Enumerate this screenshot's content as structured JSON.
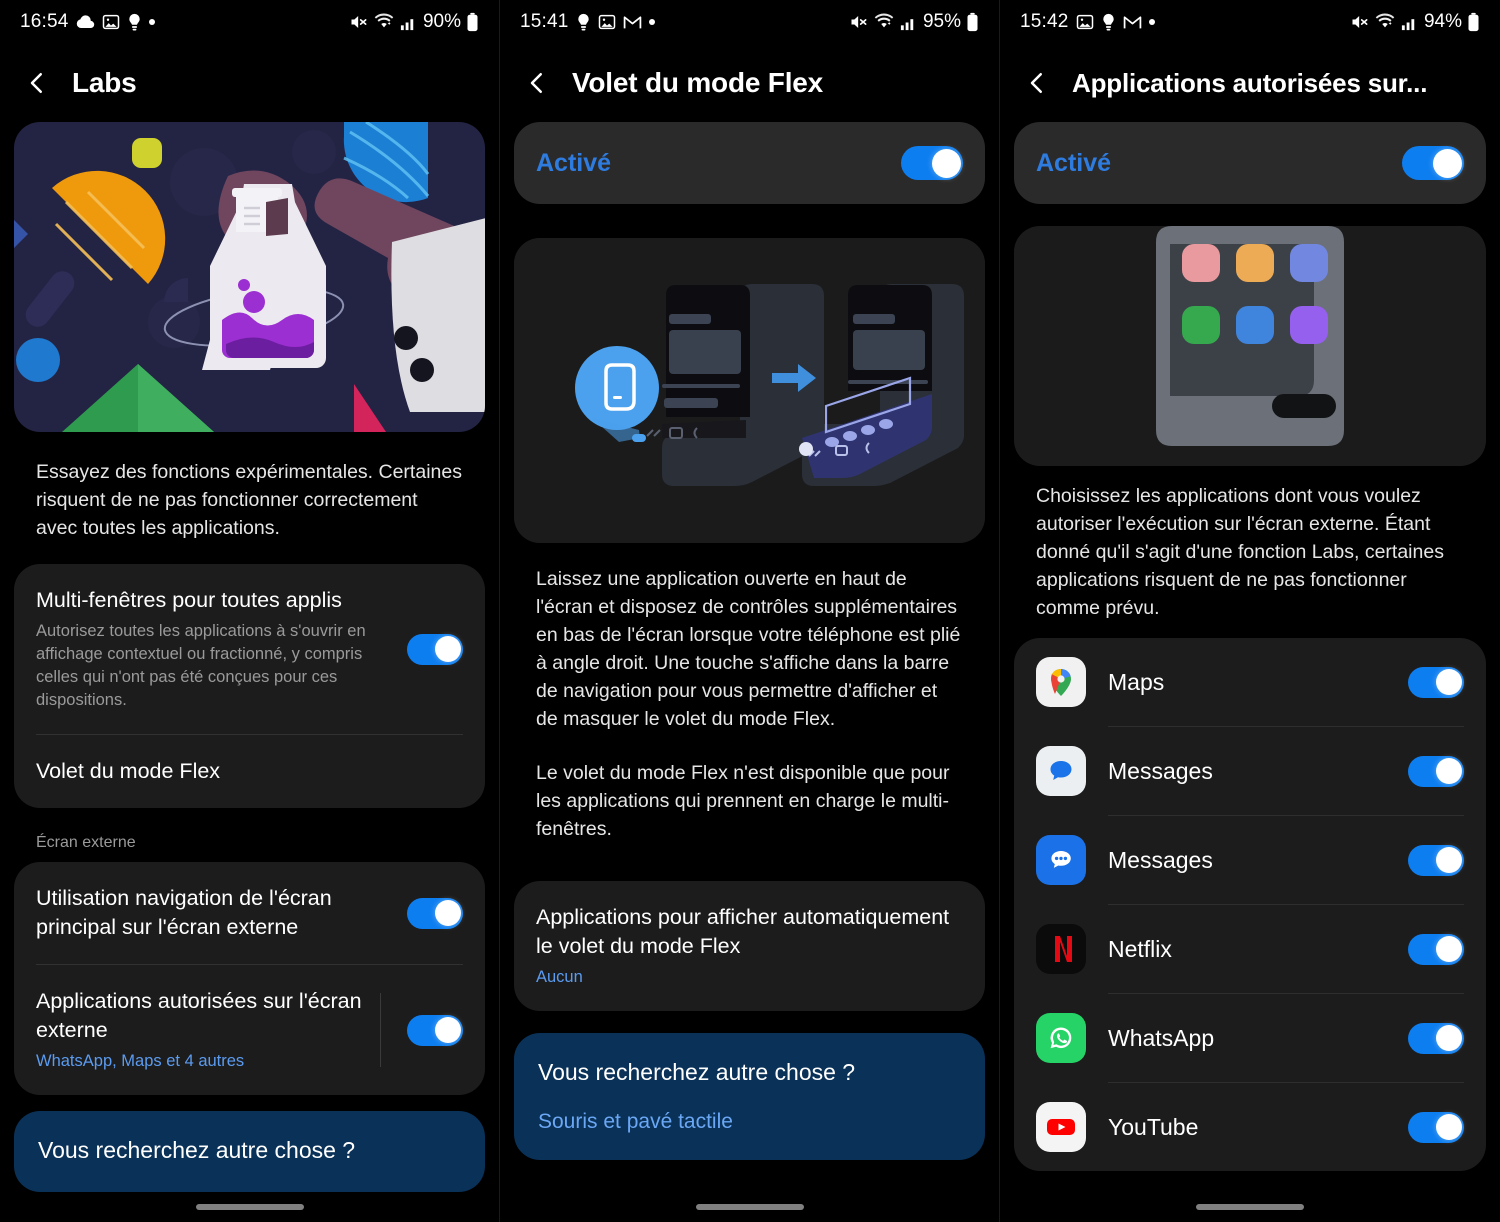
{
  "panels": [
    {
      "status": {
        "time": "16:54",
        "battery": "90%",
        "icons": [
          "cloud-icon",
          "image-icon",
          "bulb-icon",
          "dot-icon"
        ],
        "right_icons": [
          "mute-icon",
          "wifi-icon",
          "signal-icon"
        ]
      },
      "header": {
        "title": "Labs",
        "back": "back-arrow"
      },
      "hero": "labs-illustration",
      "description": "Essayez des fonctions expérimentales. Certaines risquent de ne pas fonctionner correctement avec toutes les applications.",
      "items": [
        {
          "title": "Multi-fenêtres pour toutes applis",
          "sub": "Autorisez toutes les applications à s'ouvrir en affichage contextuel ou fractionné, y compris celles qui n'ont pas été conçues pour ces dispositions.",
          "toggle": true
        },
        {
          "title": "Volet du mode Flex",
          "sub": "",
          "toggle": false
        }
      ],
      "section_label": "Écran externe",
      "external_items": [
        {
          "title": "Utilisation navigation de l'écran principal sur l'écran externe",
          "sub": "",
          "toggle": true,
          "vdiv": false
        },
        {
          "title": "Applications autorisées sur l'écran externe",
          "sub": "WhatsApp, Maps et 4 autres",
          "toggle": true,
          "vdiv": true
        }
      ],
      "promo": {
        "title": "Vous recherchez autre chose ?",
        "link": ""
      }
    },
    {
      "status": {
        "time": "15:41",
        "battery": "95%",
        "icons": [
          "bulb-icon",
          "image-icon",
          "gmail-icon",
          "dot-icon"
        ],
        "right_icons": [
          "mute-icon",
          "wifi-icon",
          "signal-icon"
        ]
      },
      "header": {
        "title": "Volet du mode Flex",
        "back": "back-arrow"
      },
      "activated_label": "Activé",
      "hero": "flex-mode-illustration",
      "paragraphs": [
        "Laissez une application ouverte en haut de l'écran et disposez de contrôles supplémentaires en bas de l'écran lorsque votre téléphone est plié à angle droit. Une touche s'affiche dans la barre de navigation pour vous permettre d'afficher et de masquer le volet du mode Flex.",
        "Le volet du mode Flex n'est disponible que pour les applications qui prennent en charge le multi-fenêtres."
      ],
      "setting": {
        "title": "Applications pour afficher automatiquement le volet du mode Flex",
        "sub": "Aucun"
      },
      "promo": {
        "title": "Vous recherchez autre chose ?",
        "link": "Souris et pavé tactile"
      }
    },
    {
      "status": {
        "time": "15:42",
        "battery": "94%",
        "icons": [
          "image-icon",
          "bulb-icon",
          "gmail-icon",
          "dot-icon"
        ],
        "right_icons": [
          "mute-icon",
          "wifi-icon",
          "signal-icon"
        ]
      },
      "header": {
        "title": "Applications autorisées sur...",
        "back": "back-arrow"
      },
      "activated_label": "Activé",
      "hero": "external-screen-illustration",
      "description": "Choisissez les applications dont vous voulez autoriser l'exécution sur l'écran externe. Étant donné qu'il s'agit d'une fonction Labs, certaines applications risquent de ne pas fonctionner comme prévu.",
      "apps": [
        {
          "name": "Maps",
          "icon": "google-maps-icon",
          "toggle": true
        },
        {
          "name": "Messages",
          "icon": "samsung-messages-icon",
          "toggle": true
        },
        {
          "name": "Messages",
          "icon": "google-messages-icon",
          "toggle": true
        },
        {
          "name": "Netflix",
          "icon": "netflix-icon",
          "toggle": true
        },
        {
          "name": "WhatsApp",
          "icon": "whatsapp-icon",
          "toggle": true
        },
        {
          "name": "YouTube",
          "icon": "youtube-icon",
          "toggle": true
        }
      ]
    }
  ],
  "colors": {
    "accent_blue": "#0d7ef0",
    "link_blue": "#5b9bf0",
    "promo_bg": "#0a3157",
    "card_bg": "#1c1c1c",
    "card_bg_light": "#2a2a2a"
  }
}
